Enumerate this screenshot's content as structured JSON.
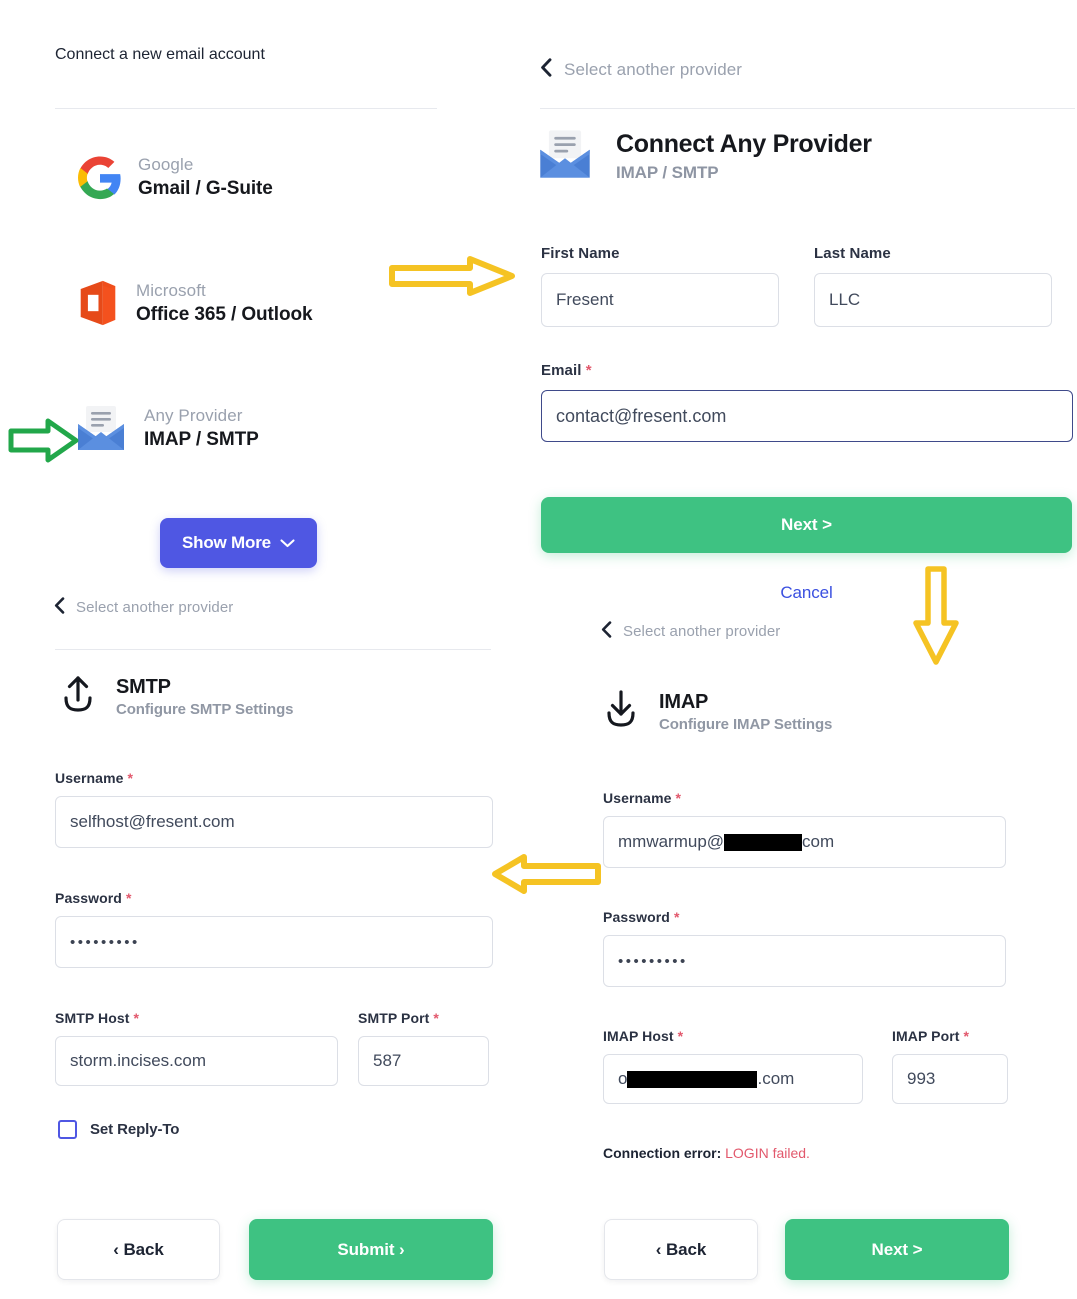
{
  "left_panel": {
    "title": "Connect a new email account",
    "providers": [
      {
        "sub": "Google",
        "main": "Gmail / G-Suite",
        "icon": "google-icon"
      },
      {
        "sub": "Microsoft",
        "main": "Office 365 / Outlook",
        "icon": "microsoft-office-icon"
      },
      {
        "sub": "Any Provider",
        "main": "IMAP / SMTP",
        "icon": "envelope-icon"
      }
    ],
    "show_more_label": "Show More",
    "show_more_icon": "chevron-down-icon",
    "back_link": "Select another provider",
    "smtp": {
      "icon": "upload-arrow-icon",
      "title": "SMTP",
      "subtitle": "Configure SMTP Settings",
      "username_label": "Username",
      "username_value": "selfhost@fresent.com",
      "password_label": "Password",
      "password_value": "•••••••••",
      "host_label": "SMTP Host",
      "host_value": "storm.incises.com",
      "port_label": "SMTP Port",
      "port_value": "587",
      "reply_to_label": "Set Reply-To",
      "reply_to_checked": false
    },
    "footer": {
      "back_label": "‹ Back",
      "submit_label": "Submit ›"
    }
  },
  "right_panel": {
    "back_link_top": "Select another provider",
    "header": {
      "icon": "envelope-icon",
      "title": "Connect Any Provider",
      "subtitle": "IMAP / SMTP"
    },
    "first_name_label": "First Name",
    "first_name_value": "Fresent",
    "last_name_label": "Last Name",
    "last_name_value": "LLC",
    "email_label": "Email",
    "email_value": "contact@fresent.com",
    "next_label": "Next >",
    "cancel_label": "Cancel",
    "back_link_mid": "Select another provider",
    "imap": {
      "icon": "download-arrow-icon",
      "title": "IMAP",
      "subtitle": "Configure IMAP Settings",
      "username_label": "Username",
      "username_prefix": "mmwarmup@",
      "username_suffix": "com",
      "username_redacted": true,
      "password_label": "Password",
      "password_value": "•••••••••",
      "host_label": "IMAP Host",
      "host_prefix": "o",
      "host_suffix": ".com",
      "host_redacted": true,
      "port_label": "IMAP Port",
      "port_value": "993",
      "error_prefix": "Connection error:",
      "error_message": "LOGIN failed."
    },
    "footer": {
      "back_label": "‹ Back",
      "next_label": "Next >"
    }
  },
  "annotations": {
    "arrow_right_green": {
      "name": "green-right-arrow-annotation",
      "color": "#22a74a"
    },
    "arrow_right_yellow": {
      "name": "yellow-right-arrow-annotation",
      "color": "#f5c323"
    },
    "arrow_down_yellow": {
      "name": "yellow-down-arrow-annotation",
      "color": "#f5c323"
    },
    "arrow_left_yellow": {
      "name": "yellow-left-arrow-annotation",
      "color": "#f5c323"
    }
  },
  "colors": {
    "primary_blue": "#4f57e3",
    "green": "#3ec282",
    "link_blue": "#3b50e0",
    "error_red": "#e2586c",
    "muted": "#9aa1ae"
  }
}
